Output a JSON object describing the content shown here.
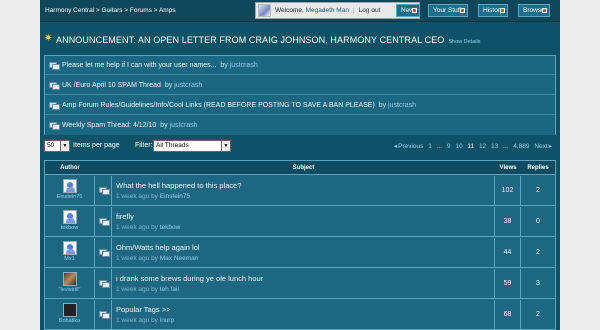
{
  "header": {
    "breadcrumb": "Harmony Central > Guitars > Forums > Amps",
    "welcome": "Welcome,",
    "username": "Megadeth Man",
    "logout": "Log out",
    "nav": [
      "New",
      "Your Stuff",
      "History",
      "Browse"
    ]
  },
  "announcement": {
    "title": "ANNOUNCEMENT: AN OPEN LETTER FROM CRAIG JOHNSON, HARMONY CENTRAL CEO",
    "show_details": "Show Details"
  },
  "sticky": [
    {
      "title": "Please let me help if I can with your user names...",
      "by": "by",
      "author": "justcrash"
    },
    {
      "title": "UK /Euro April 10 SPAM Thread",
      "by": "by",
      "author": "justcrash"
    },
    {
      "title": "Amp Forum Rules/Guidelines/Info/Cool Links (READ BEFORE POSTING TO SAVE A BAN PLEASE)",
      "by": "by",
      "author": "justcrash"
    },
    {
      "title": "Weekly Spam Thread: 4/12/10",
      "by": "by",
      "author": "justcrash"
    }
  ],
  "controls": {
    "per_page_value": "50",
    "per_page_label": "Items per page",
    "filter_label": "Filter:",
    "filter_value": "All Threads",
    "pager": {
      "previous": "Previous",
      "pages": [
        "1",
        "...",
        "9",
        "10",
        "11",
        "12",
        "13",
        "...",
        "4,889"
      ],
      "current": "11",
      "next": "Next"
    }
  },
  "table": {
    "headers": {
      "author": "Author",
      "subject": "Subject",
      "views": "Views",
      "replies": "Replies"
    },
    "rows": [
      {
        "author": "Einstein75",
        "subject": "What the hell happened to this place?",
        "time": "1 week ago",
        "by": "by",
        "last": "Einstein75",
        "views": "102",
        "replies": "2",
        "avatar": "default"
      },
      {
        "author": "tekbow",
        "subject": "firefly",
        "time": "1 week ago",
        "by": "by",
        "last": "tekbow",
        "views": "38",
        "replies": "0",
        "avatar": "default"
      },
      {
        "author": "Mx1",
        "subject": "Ohm/Watts help again lol",
        "time": "1 week ago",
        "by": "by",
        "last": "Max Neeman",
        "views": "44",
        "replies": "2",
        "avatar": "default"
      },
      {
        "author": "\"levistrill\"",
        "subject": "i drank some brews during ye ole lunch hour",
        "time": "1 week ago",
        "by": "by",
        "last": "teh fail",
        "views": "59",
        "replies": "3",
        "avatar": "photo"
      },
      {
        "author": "Bobatika",
        "subject": "Popular Tags >>",
        "time": "1 week ago",
        "by": "by",
        "last": "inurp",
        "views": "68",
        "replies": "2",
        "avatar": "dark"
      }
    ]
  },
  "colors": {
    "background": "#0e5268",
    "header": "#10465a",
    "panel": "#1d6880",
    "border": "#5aa5c0",
    "link": "#8fd0ee",
    "accent": "#d9532c",
    "star": "#ffd23a"
  }
}
